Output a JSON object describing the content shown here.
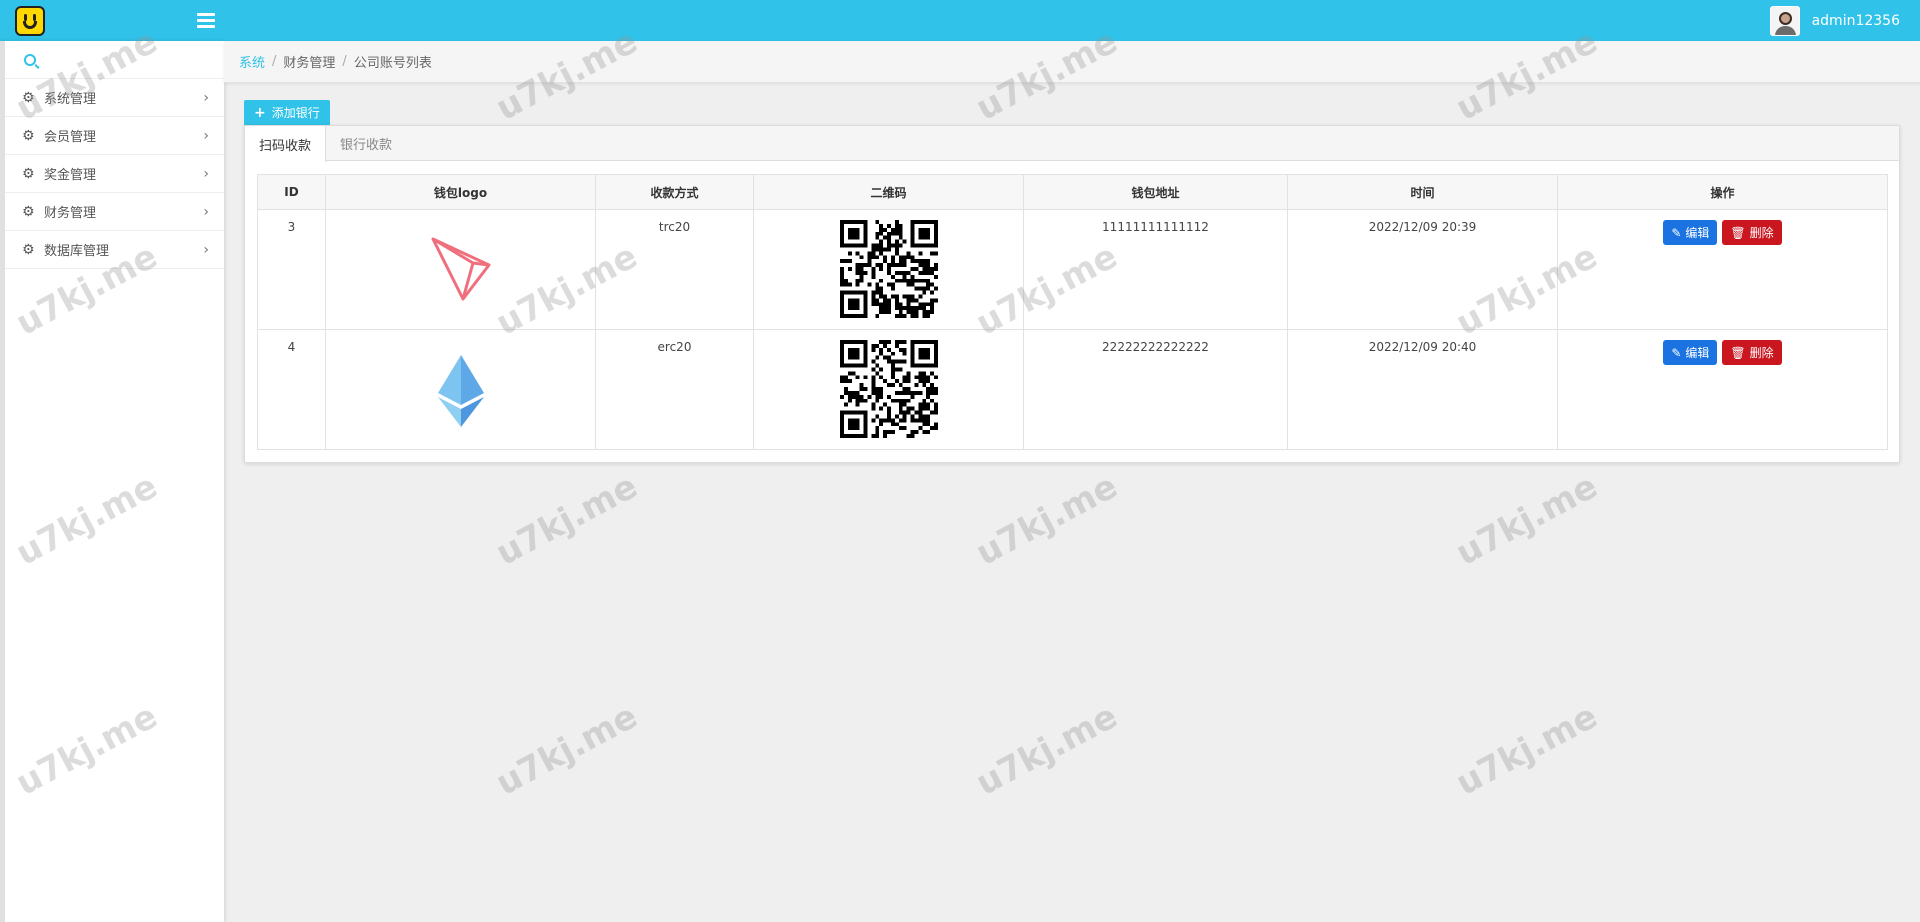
{
  "header": {
    "username": "admin12356"
  },
  "sidebar": {
    "items": [
      {
        "label": "系统管理"
      },
      {
        "label": "会员管理"
      },
      {
        "label": "奖金管理"
      },
      {
        "label": "财务管理"
      },
      {
        "label": "数据库管理"
      }
    ]
  },
  "breadcrumb": {
    "root": "系统",
    "level2": "财务管理",
    "current": "公司账号列表"
  },
  "toolbar": {
    "add_label": "添加银行"
  },
  "tabs": [
    {
      "label": "扫码收款"
    },
    {
      "label": "银行收款"
    }
  ],
  "table": {
    "headers": [
      "ID",
      "钱包logo",
      "收款方式",
      "二维码",
      "钱包地址",
      "时间",
      "操作"
    ],
    "rows": [
      {
        "id": "3",
        "logo": "tron-logo-icon",
        "method": "trc20",
        "address": "11111111111112",
        "time": "2022/12/09 20:39"
      },
      {
        "id": "4",
        "logo": "ethereum-logo-icon",
        "method": "erc20",
        "address": "22222222222222",
        "time": "2022/12/09 20:40"
      }
    ],
    "edit_label": "编辑",
    "delete_label": "删除"
  },
  "watermark": "u7kj.me",
  "colors": {
    "accent": "#30c2e8",
    "edit": "#1a73e0",
    "delete": "#c9161f"
  }
}
